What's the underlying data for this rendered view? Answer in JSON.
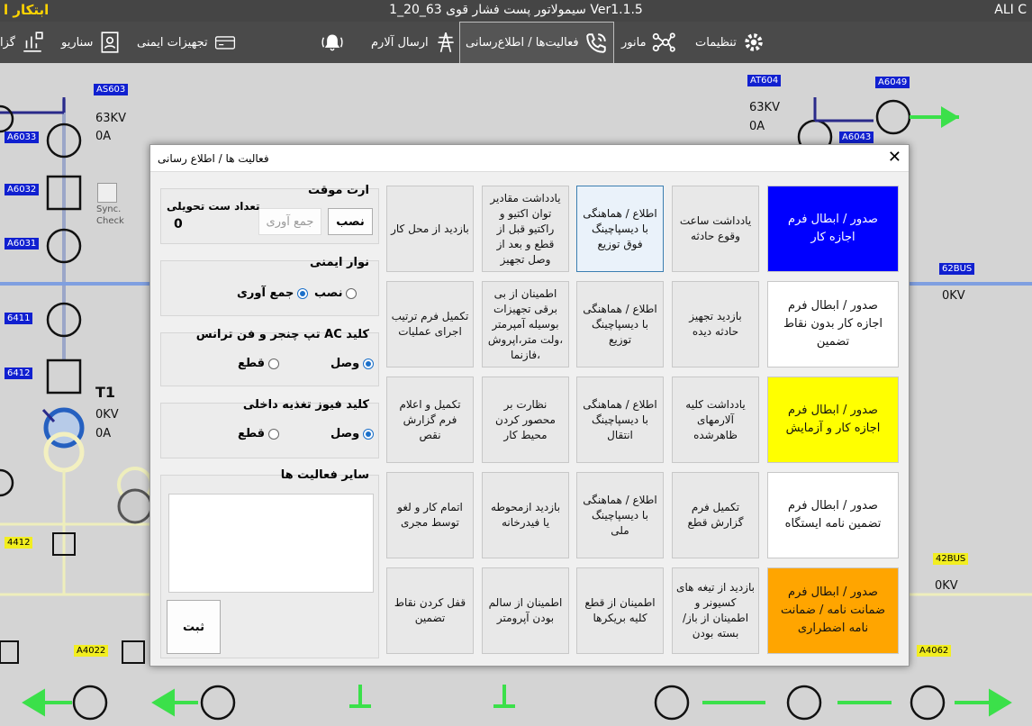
{
  "window": {
    "title_left": "ابتکار ا",
    "title": "سیمولاتور پست فشار قوی 63_20_1 Ver1.1.5",
    "title_right": "ALI C"
  },
  "toolbar": {
    "settings": "تنظیمات",
    "maneuver": "مانور",
    "activities": "فعالیت‌ها / اطلاع‌رسانی",
    "alarm_send": "ارسال آلارم",
    "safety": "تجهیزات ایمنی",
    "scenario": "سناریو",
    "reports": "گزا"
  },
  "diagram": {
    "tags": {
      "as603": "AS603",
      "a6033": "A6033",
      "a6032": "A6032",
      "a6031": "A6031",
      "t6411": "6411",
      "t6412": "6412",
      "t4412": "4412",
      "a4022": "A4022",
      "at604": "AT604",
      "a6049": "A6049",
      "a6043": "A6043",
      "bus62": "62BUS",
      "bus42": "42BUS",
      "a4062": "A4062"
    },
    "labels": {
      "kv63_left": "63KV",
      "a0_left": "0A",
      "sync1": "Sync.",
      "sync2": "Check",
      "t1": "T1",
      "t1_kv": "0KV",
      "t1_a": "0A",
      "kv63_right": "63KV",
      "a0_right": "0A",
      "bus62_kv": "0KV",
      "bus42_kv": "0KV"
    }
  },
  "dialog": {
    "title": "فعالیت ها / اطلاع رسانی",
    "grid": [
      [
        "بازدید از محل کار",
        "یادداشت مقادیر توان اکتیو و راکتیو قبل از قطع و بعد از وصل تجهیز",
        "اطلاع / هماهنگی با دیسپاچینگ فوق توزیع",
        "یادداشت ساعت وقوع حادثه"
      ],
      [
        "تکمیل فرم ترتیب اجرای عملیات",
        "اطمینان از بی برقی تجهیزات بوسیله آمپرمتر ،ولت متر،اپروش ،فازنما",
        "اطلاع / هماهنگی با دیسپاچینگ توزیع",
        "بازدید تجهیز حادثه دیده"
      ],
      [
        "تکمیل و اعلام فرم گزارش نقص",
        "نظارت بر محصور کردن محیط کار",
        "اطلاع / هماهنگی با دیسپاچینگ انتقال",
        "یادداشت کلیه آلارمهای ظاهرشده"
      ],
      [
        "اتمام کار و لغو توسط مجری",
        "بازدید ازمحوطه یا فیدرخانه",
        "اطلاع / هماهنگی با دیسپاچینگ ملی",
        "تکمیل فرم گزارش قطع"
      ],
      [
        "قفل کردن نقاط تضمین",
        "اطمینان از سالم بودن آپرومتر",
        "اطمینان از قطع کلیه بریکرها",
        "بازدید از تیغه های کسیونر و اطمینان از باز/بسته بودن"
      ]
    ],
    "big": [
      {
        "label": "صدور / ابطال فرم اجازه کار",
        "bg": "#0000ff",
        "fg": "#ffffff"
      },
      {
        "label": "صدور / ابطال فرم اجازه کار بدون نقاط تضمین",
        "bg": "#ffffff",
        "fg": "#111111"
      },
      {
        "label": "صدور / ابطال فرم اجازه کار و آزمایش",
        "bg": "#ffff00",
        "fg": "#111111"
      },
      {
        "label": "صدور / ابطال فرم تضمین نامه ایستگاه",
        "bg": "#ffffff",
        "fg": "#111111"
      },
      {
        "label": "صدور / ابطال فرم ضمانت نامه / ضمانت نامه اضطراری",
        "bg": "#ffa500",
        "fg": "#111111"
      }
    ],
    "temp_earth": {
      "title": "ارت موقت",
      "install": "نصب",
      "collect": "جمع آوری",
      "count_label": "تعداد ست تحویلی",
      "count": "0"
    },
    "safety_tape": {
      "title": "نوار ایمنی",
      "install": "نصب",
      "collect": "جمع آوری"
    },
    "ac_key": {
      "title": "کلید AC تپ چنجر و فن ترانس",
      "on": "وصل",
      "off": "قطع"
    },
    "fuse_key": {
      "title": "کلید فیوز تغذیه داخلی",
      "on": "وصل",
      "off": "قطع"
    },
    "other": {
      "title": "سایر فعالیت ها",
      "value": ""
    },
    "submit": "ثبت"
  }
}
